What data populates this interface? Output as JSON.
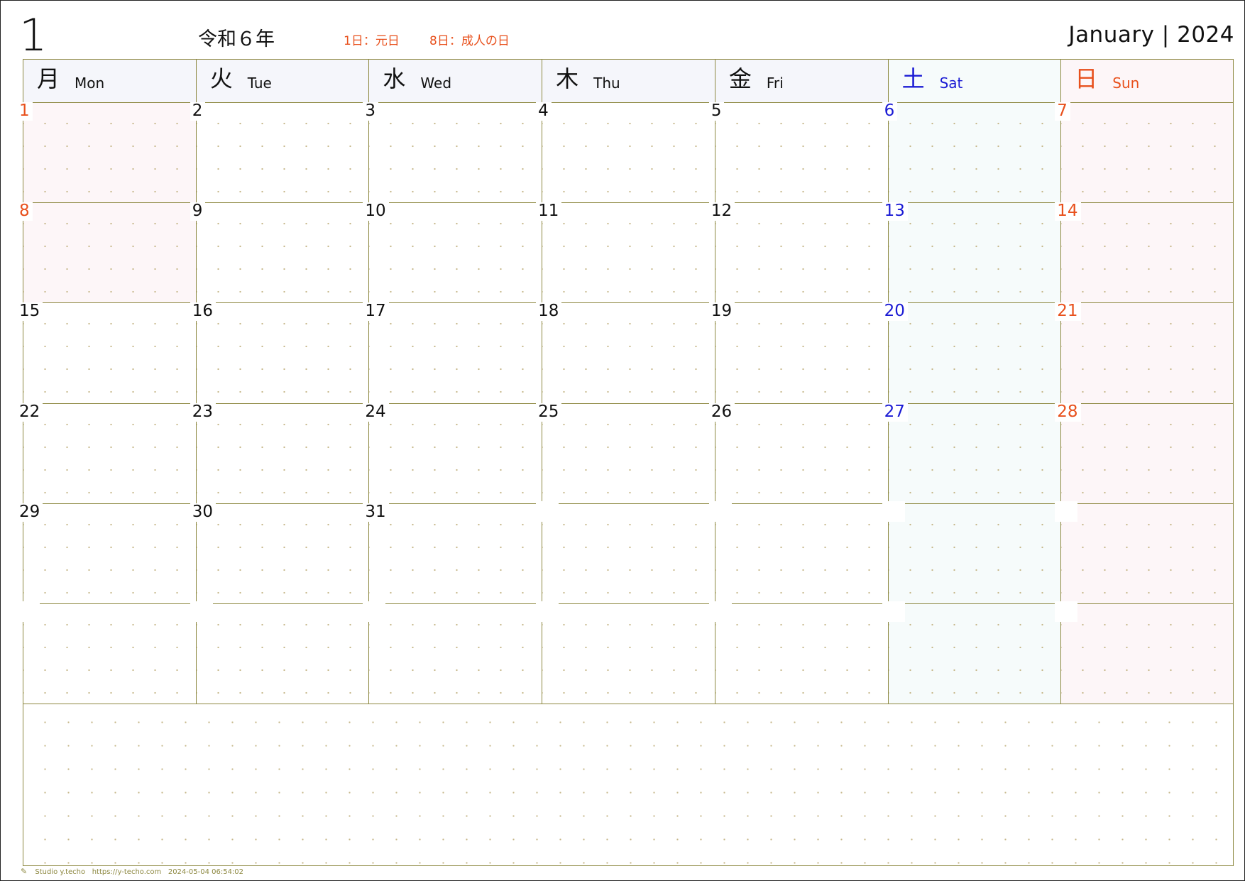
{
  "header": {
    "month_number": "1",
    "era_year": "令和６年",
    "holidays": [
      "1日：元日",
      "8日：成人の日"
    ],
    "month_year": "January | 2024"
  },
  "weekdays": [
    {
      "kanji": "月",
      "en": "Mon"
    },
    {
      "kanji": "火",
      "en": "Tue"
    },
    {
      "kanji": "水",
      "en": "Wed"
    },
    {
      "kanji": "木",
      "en": "Thu"
    },
    {
      "kanji": "金",
      "en": "Fri"
    },
    {
      "kanji": "土",
      "en": "Sat"
    },
    {
      "kanji": "日",
      "en": "Sun"
    }
  ],
  "weeks": [
    [
      "1",
      "2",
      "3",
      "4",
      "5",
      "6",
      "7"
    ],
    [
      "8",
      "9",
      "10",
      "11",
      "12",
      "13",
      "14"
    ],
    [
      "15",
      "16",
      "17",
      "18",
      "19",
      "20",
      "21"
    ],
    [
      "22",
      "23",
      "24",
      "25",
      "26",
      "27",
      "28"
    ],
    [
      "29",
      "30",
      "31",
      "",
      "",
      "",
      ""
    ],
    [
      "",
      "",
      "",
      "",
      "",
      "",
      ""
    ]
  ],
  "holiday_days": [
    "1",
    "8"
  ],
  "colors": {
    "saturday": "#1a1ad4",
    "sunday_holiday": "#e8501c",
    "weekday": "#111111",
    "grid": "#8d8840",
    "weekday_header_bg": "#f5f6fb",
    "saturday_bg": "#f6fbfb",
    "sunday_bg": "#fdf6f8"
  },
  "footer": {
    "brand": "Studio y.techo",
    "url": "https://y-techo.com",
    "timestamp": "2024-05-04 06:54:02"
  }
}
